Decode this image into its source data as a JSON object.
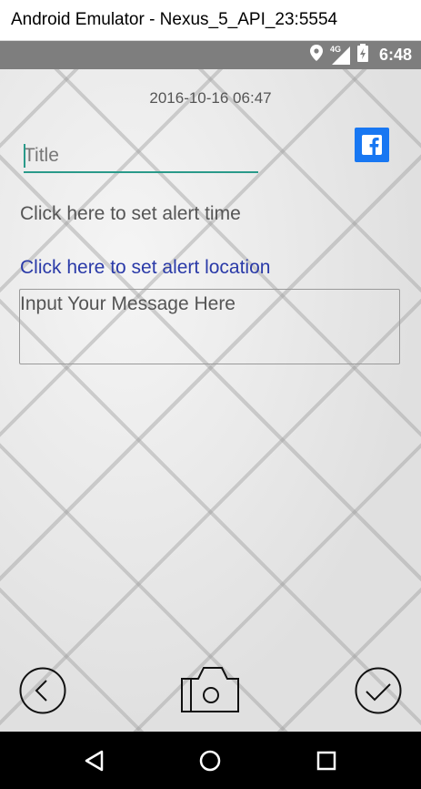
{
  "window": {
    "title": "Android Emulator - Nexus_5_API_23:5554"
  },
  "status_bar": {
    "time": "6:48",
    "network": "4G",
    "icons": [
      "location-icon",
      "signal-icon",
      "battery-icon"
    ]
  },
  "note": {
    "date": "2016-10-16 06:47",
    "title_placeholder": "Title",
    "alert_time_label": "Click here to set alert time",
    "alert_location_label": "Click here to set alert location",
    "message_placeholder": "Input Your Message Here"
  },
  "colors": {
    "accent": "#2a9a8a",
    "facebook": "#1877f2",
    "link": "#2a3aa8"
  },
  "bottom_bar": {
    "icons": [
      "back-circle-icon",
      "camera-icon",
      "check-circle-icon"
    ]
  },
  "nav_bar": {
    "icons": [
      "nav-back-icon",
      "nav-home-icon",
      "nav-recent-icon"
    ]
  }
}
